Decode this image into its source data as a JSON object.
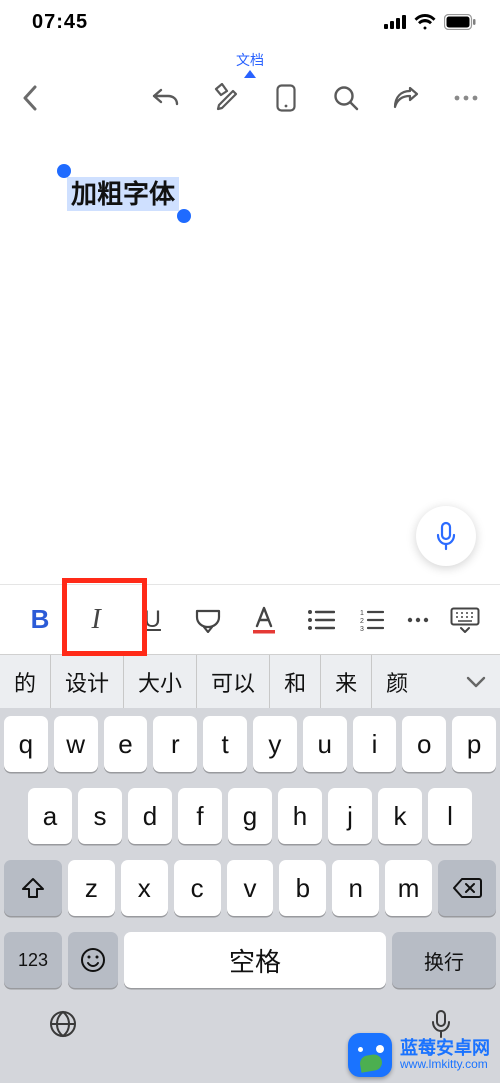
{
  "status": {
    "time": "07:45"
  },
  "toolbar": {
    "doc_label": "文档"
  },
  "document": {
    "selected_text": "加粗字体"
  },
  "format_bar": {
    "bold": "B",
    "italic": "I",
    "underline": "U"
  },
  "suggestions": [
    "的",
    "设计",
    "大小",
    "可以",
    "和",
    "来",
    "颜"
  ],
  "keyboard": {
    "row1": [
      "q",
      "w",
      "e",
      "r",
      "t",
      "y",
      "u",
      "i",
      "o",
      "p"
    ],
    "row2": [
      "a",
      "s",
      "d",
      "f",
      "g",
      "h",
      "j",
      "k",
      "l"
    ],
    "row3": [
      "z",
      "x",
      "c",
      "v",
      "b",
      "n",
      "m"
    ],
    "numkey": "123",
    "space": "空格",
    "return": "换行"
  },
  "watermark": {
    "title": "蓝莓安卓网",
    "url": "www.lmkitty.com"
  }
}
